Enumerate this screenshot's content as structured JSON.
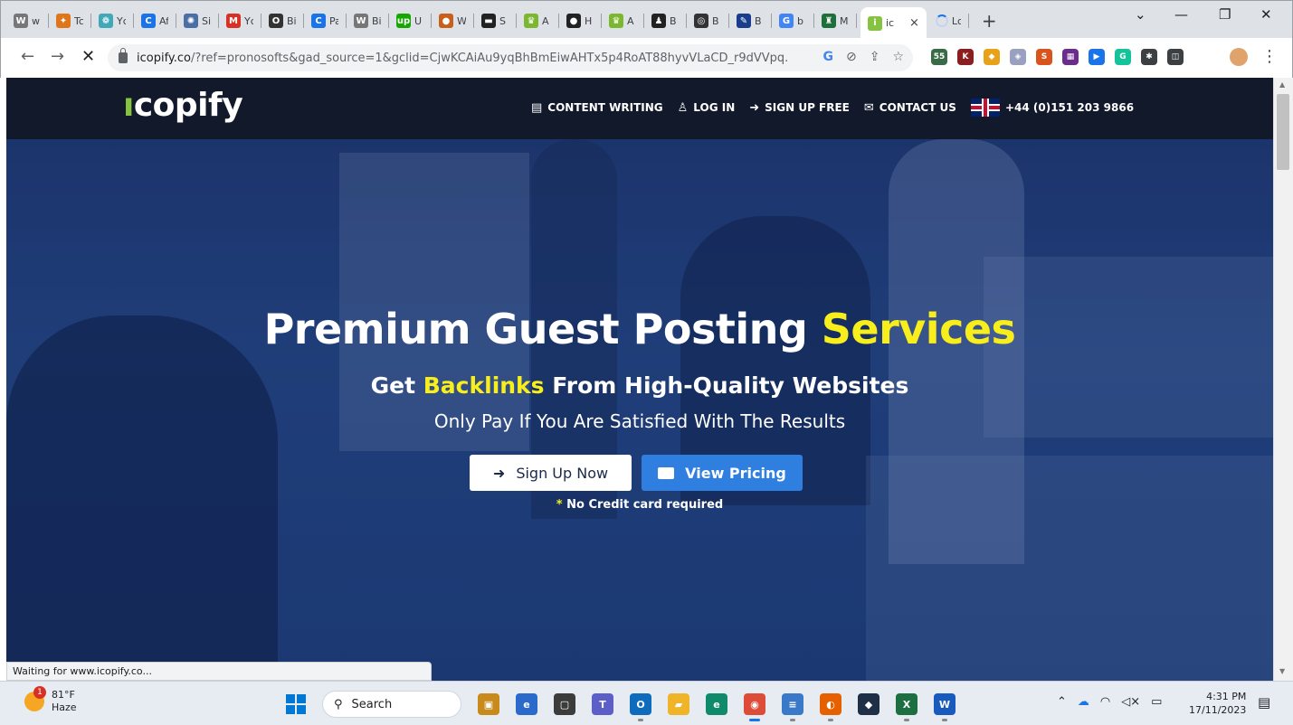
{
  "browser": {
    "tabs": [
      {
        "title": "wi",
        "icon": "wikipedia-icon",
        "color": "#777777",
        "glyph": "W"
      },
      {
        "title": "Tc",
        "icon": "maple-leaf-icon",
        "color": "#e0761a",
        "glyph": "✦"
      },
      {
        "title": "Yc",
        "icon": "paw-icon",
        "color": "#40a9b8",
        "glyph": "❁"
      },
      {
        "title": "Af",
        "icon": "chrome-c-icon",
        "color": "#1a73e8",
        "glyph": "C"
      },
      {
        "title": "Si",
        "icon": "molecule-icon",
        "color": "#4a6fa5",
        "glyph": "✺"
      },
      {
        "title": "Yc",
        "icon": "gmail-icon",
        "color": "#d93025",
        "glyph": "M"
      },
      {
        "title": "Bi",
        "icon": "circle-icon",
        "color": "#333333",
        "glyph": "O"
      },
      {
        "title": "Pa",
        "icon": "chrome-c-icon",
        "color": "#1a73e8",
        "glyph": "C"
      },
      {
        "title": "Bi",
        "icon": "wordpress-icon",
        "color": "#777777",
        "glyph": "W"
      },
      {
        "title": "U",
        "icon": "upwork-icon",
        "color": "#14a800",
        "glyph": "up"
      },
      {
        "title": "W",
        "icon": "orange-circle-icon",
        "color": "#c8601a",
        "glyph": "●"
      },
      {
        "title": "S",
        "icon": "dark-square-icon",
        "color": "#222222",
        "glyph": "▬"
      },
      {
        "title": "A",
        "icon": "crown-icon",
        "color": "#7cb82f",
        "glyph": "♛"
      },
      {
        "title": "H",
        "icon": "avatar-icon",
        "color": "#222222",
        "glyph": "●"
      },
      {
        "title": "A",
        "icon": "crown-icon",
        "color": "#7cb82f",
        "glyph": "♛"
      },
      {
        "title": "B",
        "icon": "person-icon",
        "color": "#222222",
        "glyph": "♟"
      },
      {
        "title": "B",
        "icon": "target-icon",
        "color": "#333333",
        "glyph": "◎"
      },
      {
        "title": "B",
        "icon": "quill-icon",
        "color": "#1a3c8c",
        "glyph": "✎"
      },
      {
        "title": "b",
        "icon": "google-icon",
        "color": "#4285f4",
        "glyph": "G"
      },
      {
        "title": "M",
        "icon": "hat-icon",
        "color": "#1e6f3a",
        "glyph": "♜"
      }
    ],
    "active_tab": {
      "title": "ic",
      "close": "×"
    },
    "loading_tab": {
      "title": "Lc"
    },
    "new_tab": "+",
    "window_controls": {
      "dropdown": "⌄",
      "minimize": "—",
      "restore": "❐",
      "close": "✕"
    },
    "url_main": "icopify.co",
    "url_rest": "/?ref=pronosofts&gad_source=1&gclid=CjwKCAiAu9yqBhBmEiwAHTx5p4RoAT88hyvVLaCD_r9dVVpq...",
    "omnibox_icons": {
      "google": "G",
      "eye_off": "⊘",
      "share": "⇪",
      "star": "☆"
    },
    "extensions": [
      {
        "name": "seo-ext-icon",
        "color": "#3a6b47",
        "glyph": "55"
      },
      {
        "name": "k-ext-icon",
        "color": "#8b1e1e",
        "glyph": "K"
      },
      {
        "name": "colorful-ext-icon",
        "color": "#e8a21a",
        "glyph": "◆"
      },
      {
        "name": "shield-ext-icon",
        "color": "#9aa0c0",
        "glyph": "◈"
      },
      {
        "name": "s-ext-icon",
        "color": "#d9531e",
        "glyph": "S"
      },
      {
        "name": "grid-ext-icon",
        "color": "#6b2d8c",
        "glyph": "▦"
      },
      {
        "name": "play-ext-icon",
        "color": "#1a73e8",
        "glyph": "▶"
      },
      {
        "name": "grammarly-ext-icon",
        "color": "#15c39a",
        "glyph": "G"
      },
      {
        "name": "puzzle-ext-icon",
        "color": "#3c4043",
        "glyph": "✱"
      },
      {
        "name": "sidepanel-ext-icon",
        "color": "#3c4043",
        "glyph": "◫"
      }
    ],
    "status_text": "Waiting for www.icopify.co..."
  },
  "site": {
    "logo": "copify",
    "nav": [
      {
        "label": "CONTENT WRITING",
        "icon": "document-icon",
        "glyph": "▤"
      },
      {
        "label": "LOG IN",
        "icon": "user-icon",
        "glyph": "♙"
      },
      {
        "label": "SIGN UP FREE",
        "icon": "sign-in-icon",
        "glyph": "➜"
      },
      {
        "label": "CONTACT US",
        "icon": "contact-icon",
        "glyph": "✉"
      }
    ],
    "phone": "+44 (0)151 203 9866"
  },
  "hero": {
    "title_main": "Premium Guest Posting ",
    "title_highlight": "Services",
    "subtitle_prefix": "Get ",
    "subtitle_highlight": "Backlinks",
    "subtitle_suffix": " From High-Quality Websites",
    "tagline": "Only Pay If You Are Satisfied With The Results",
    "signup_button": "Sign Up Now",
    "pricing_button": "View Pricing",
    "note_star": "*",
    "note": " No Credit card required"
  },
  "taskbar": {
    "temperature": "81°F",
    "weather": "Haze",
    "weather_badge": "1",
    "search_label": "Search",
    "time": "4:31 PM",
    "date": "17/11/2023",
    "colors": {
      "accent": "#0078d4"
    }
  },
  "colors": {
    "header_bg": "#11192b",
    "highlight_yellow": "#f7ee1b",
    "logo_green": "#85c341",
    "pricing_blue": "#2f7fe0"
  }
}
